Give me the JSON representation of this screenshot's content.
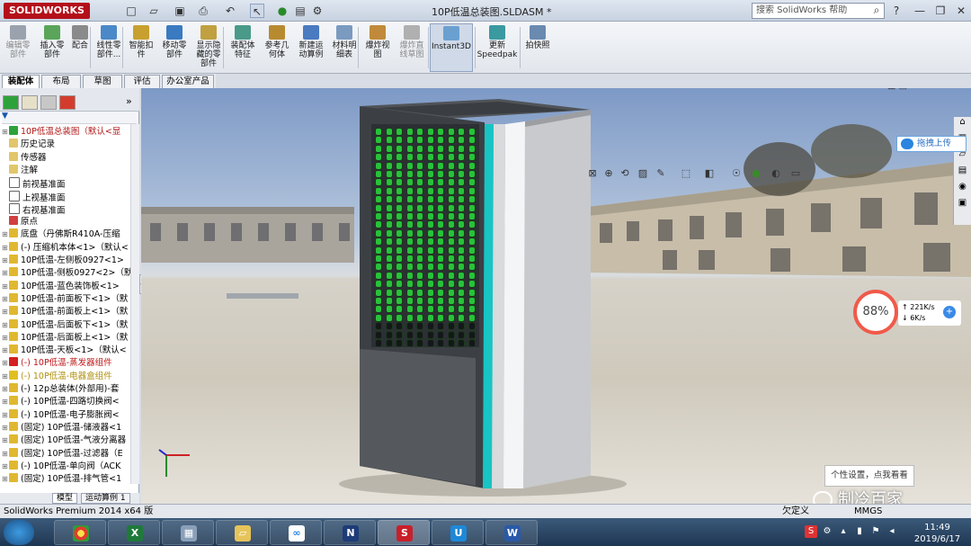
{
  "app": {
    "logo_text": "SOLIDWORKS",
    "document_title": "10P低温总装图.SLDASM *",
    "search_placeholder": "搜索 SolidWorks 帮助",
    "help_label": "?",
    "minimize": "—",
    "restore": "❐",
    "close": "✕"
  },
  "toolbar": {
    "buttons": [
      {
        "label": "编辑零\n部件",
        "disabled": true
      },
      {
        "label": "插入零\n部件",
        "disabled": false
      },
      {
        "label": "配合",
        "disabled": false
      },
      {
        "label": "线性零\n部件...",
        "disabled": false
      },
      {
        "label": "智能扣\n件",
        "disabled": false
      },
      {
        "label": "移动零\n部件",
        "disabled": false
      },
      {
        "label": "显示隐\n藏的零\n部件",
        "disabled": false
      },
      {
        "label": "装配体\n特征",
        "disabled": false
      },
      {
        "label": "参考几\n何体",
        "disabled": false
      },
      {
        "label": "新建运\n动算例",
        "disabled": false
      },
      {
        "label": "材料明\n细表",
        "disabled": false
      },
      {
        "label": "爆炸视\n图",
        "disabled": false
      },
      {
        "label": "爆炸直\n线草图",
        "disabled": true
      },
      {
        "label": "Instant3D",
        "disabled": false
      },
      {
        "label": "更新\nSpeedpak",
        "disabled": false
      },
      {
        "label": "拍快照",
        "disabled": false
      }
    ],
    "tabs": [
      "装配体",
      "布局",
      "草图",
      "评估",
      "办公室产品"
    ]
  },
  "feature_tree": {
    "items": [
      {
        "text": "10P低温总装图（默认<显",
        "kind": "root"
      },
      {
        "text": "历史记录",
        "kind": "folder"
      },
      {
        "text": "传感器",
        "kind": "folder"
      },
      {
        "text": "注解",
        "kind": "folder"
      },
      {
        "text": "前视基准面",
        "kind": "plane"
      },
      {
        "text": "上视基准面",
        "kind": "plane"
      },
      {
        "text": "右视基准面",
        "kind": "plane"
      },
      {
        "text": "原点",
        "kind": "origin"
      },
      {
        "text": "底盘（丹佛斯R410A-压缩",
        "kind": "part"
      },
      {
        "text": "(-) 压缩机本体<1>（默认<",
        "kind": "part"
      },
      {
        "text": "10P低温-左侧板0927<1>",
        "kind": "part"
      },
      {
        "text": "10P低温-侧板0927<2>（默",
        "kind": "part"
      },
      {
        "text": "10P低温-蓝色装饰板<1>",
        "kind": "part"
      },
      {
        "text": "10P低温-前面板下<1>（默",
        "kind": "part"
      },
      {
        "text": "10P低温-前面板上<1>（默",
        "kind": "part"
      },
      {
        "text": "10P低温-后面板下<1>（默",
        "kind": "part"
      },
      {
        "text": "10P低温-后面板上<1>（默",
        "kind": "part"
      },
      {
        "text": "10P低温-天板<1>（默认<",
        "kind": "part"
      },
      {
        "text": "(-) 10P低温-蒸发器组件",
        "kind": "error"
      },
      {
        "text": "(-) 10P低温-电器盒组件",
        "kind": "warning"
      },
      {
        "text": "(-) 12p总装体(外部用)-套",
        "kind": "part"
      },
      {
        "text": "(-) 10P低温-四路切换阀<",
        "kind": "part"
      },
      {
        "text": "(-) 10P低温-电子膨胀阀<",
        "kind": "part"
      },
      {
        "text": "(固定) 10P低温-储液器<1",
        "kind": "part"
      },
      {
        "text": "(固定) 10P低温-气液分离器",
        "kind": "part"
      },
      {
        "text": "(固定) 10P低温-过滤器（E",
        "kind": "part"
      },
      {
        "text": "(-) 10P低温-单向阀（ACK",
        "kind": "part"
      },
      {
        "text": "(固定) 10P低温-排气管<1",
        "kind": "part"
      }
    ],
    "bottom_tabs": [
      "模型",
      "运动算例 1"
    ],
    "filter_icon": "filter-icon"
  },
  "viewport": {
    "upload_label": "拖拽上传",
    "speed_percent": "88%",
    "upload_speed": "221K/s",
    "download_speed": "6K/s",
    "tooltip": "个性设置，点我看看",
    "watermark": "制冷百家"
  },
  "status": {
    "left": "SolidWorks Premium 2014 x64 版",
    "right_1": "欠定义",
    "right_2": "MMGS"
  },
  "taskbar": {
    "time": "11:49",
    "date": "2019/6/17"
  },
  "colors": {
    "accent_cyan": "#18c4c4",
    "grille_green": "#27c23a",
    "cabinet_dark": "#454a50",
    "solidworks_red": "#b4101a"
  }
}
